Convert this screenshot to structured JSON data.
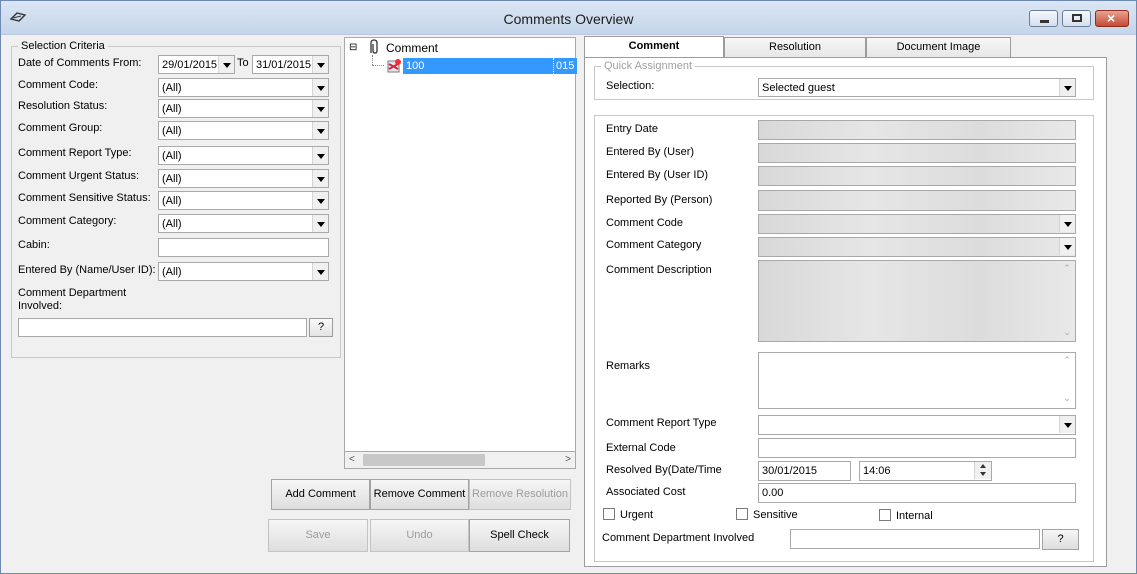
{
  "window": {
    "title": "Comments Overview",
    "icon": "window-app-icon",
    "controls": {
      "minimize": "minimize-icon",
      "maximize": "maximize-icon",
      "close": "×"
    }
  },
  "selection_criteria": {
    "title": "Selection Criteria",
    "date_from_label": "Date of Comments From:",
    "date_from": "29/01/2015",
    "to_label": "To",
    "date_to": "31/01/2015",
    "fields": [
      {
        "label": "Comment Code:",
        "value": "(All)"
      },
      {
        "label": "Resolution Status:",
        "value": "(All)"
      },
      {
        "label": "Comment Group:",
        "value": "(All)"
      },
      {
        "label": "Comment Report Type:",
        "value": "(All)"
      },
      {
        "label": "Comment Urgent Status:",
        "value": "(All)"
      },
      {
        "label": "Comment Sensitive Status:",
        "value": "(All)"
      },
      {
        "label": "Comment Category:",
        "value": "(All)"
      }
    ],
    "cabin_label": "Cabin:",
    "cabin_value": "",
    "entered_by_label": "Entered By (Name/User ID):",
    "entered_by_value": "(All)",
    "department_label_1": "Comment Department",
    "department_label_2": "Involved:",
    "department_value": "",
    "lookup_button": "?"
  },
  "tree": {
    "root_label": "Comment",
    "expander": "⊟",
    "child_label": "100",
    "child_suffix": "015",
    "root_icon": "clip-icon",
    "child_icon": "comment-item-icon",
    "scroll_left": "<",
    "scroll_right": ">"
  },
  "actions": {
    "add_comment": "Add Comment",
    "remove_comment": "Remove Comment",
    "remove_resolution": "Remove Resolution",
    "save": "Save",
    "undo": "Undo",
    "spell_check": "Spell Check"
  },
  "tabs": [
    {
      "label": "Comment",
      "active": true
    },
    {
      "label": "Resolution",
      "active": false
    },
    {
      "label": "Document Image",
      "active": false
    }
  ],
  "quick_assignment": {
    "title": "Quick Assignment",
    "selection_label": "Selection:",
    "selection_value": "Selected guest"
  },
  "detail": {
    "entry_date_label": "Entry Date",
    "entered_by_user_label": "Entered By (User)",
    "entered_by_user_id_label": "Entered By (User ID)",
    "reported_by_label": "Reported By (Person)",
    "comment_code_label": "Comment Code",
    "comment_category_label": "Comment Category",
    "comment_description_label": "Comment Description",
    "remarks_label": "Remarks",
    "report_type_label": "Comment Report Type",
    "external_code_label": "External Code",
    "resolved_by_label": "Resolved By(Date/Time",
    "resolved_date": "30/01/2015",
    "resolved_time": "14:06",
    "associated_cost_label": "Associated Cost",
    "associated_cost": "0.00",
    "urgent_label": "Urgent",
    "sensitive_label": "Sensitive",
    "internal_label": "Internal",
    "department_label": "Comment Department Involved",
    "lookup_button": "?"
  }
}
